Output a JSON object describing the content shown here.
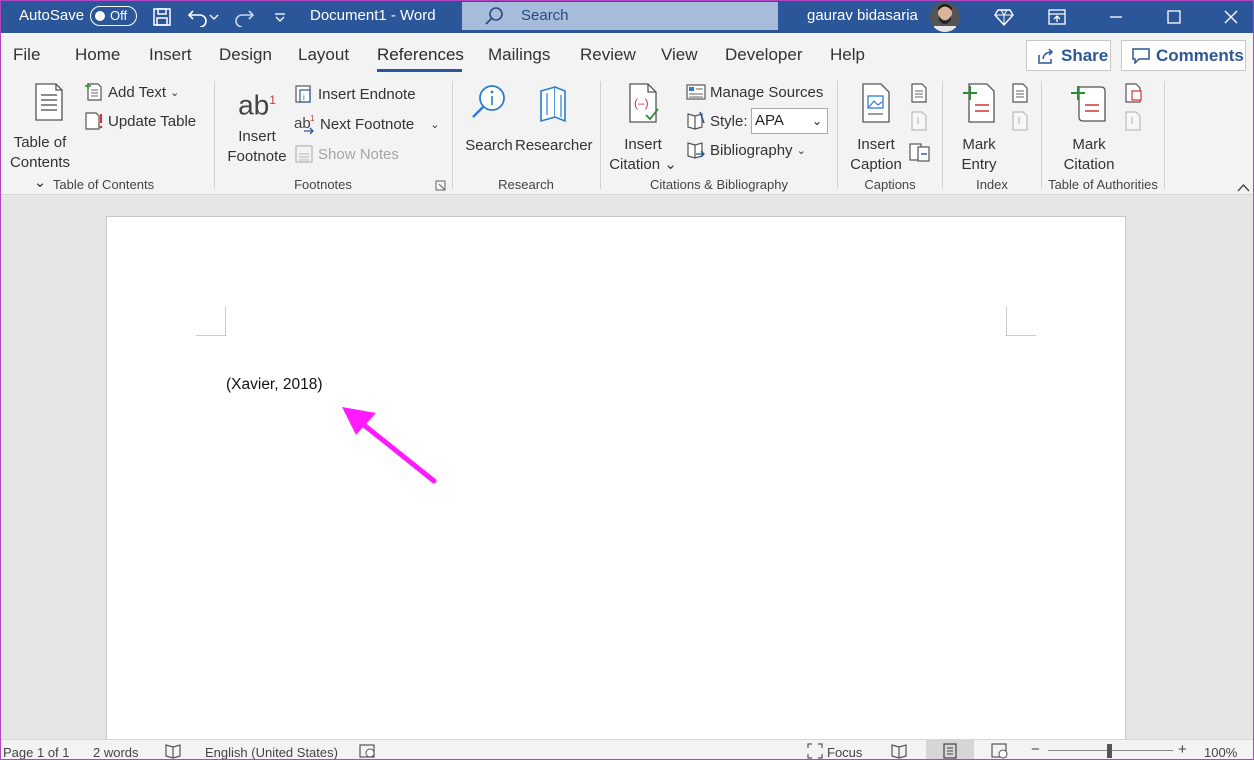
{
  "window": {
    "autosave_label": "AutoSave",
    "autosave_state": "Off",
    "doc_title": "Document1  -  Word",
    "search_placeholder": "Search",
    "user_name": "gaurav bidasaria"
  },
  "tabs": [
    "File",
    "Home",
    "Insert",
    "Design",
    "Layout",
    "References",
    "Mailings",
    "Review",
    "View",
    "Developer",
    "Help"
  ],
  "active_tab": "References",
  "header_buttons": {
    "share": "Share",
    "comments": "Comments"
  },
  "ribbon": {
    "toc": {
      "main_line1": "Table of",
      "main_line2": "Contents",
      "add_text": "Add Text",
      "update_table": "Update Table",
      "group": "Table of Contents"
    },
    "footnotes": {
      "insert_line1": "Insert",
      "insert_line2": "Footnote",
      "insert_endnote": "Insert Endnote",
      "next_footnote": "Next Footnote",
      "show_notes": "Show Notes",
      "group": "Footnotes"
    },
    "research": {
      "search": "Search",
      "researcher": "Researcher",
      "group": "Research"
    },
    "citations": {
      "insert_line1": "Insert",
      "insert_line2": "Citation",
      "manage_sources": "Manage Sources",
      "style_label": "Style:",
      "style_value": "APA",
      "bibliography": "Bibliography",
      "group": "Citations & Bibliography"
    },
    "captions": {
      "insert_line1": "Insert",
      "insert_line2": "Caption",
      "group": "Captions"
    },
    "index": {
      "mark_line1": "Mark",
      "mark_line2": "Entry",
      "group": "Index"
    },
    "authorities": {
      "mark_line1": "Mark",
      "mark_line2": "Citation",
      "group": "Table of Authorities"
    }
  },
  "document": {
    "text": "(Xavier, 2018)"
  },
  "status": {
    "page": "Page 1 of 1",
    "words": "2 words",
    "language": "English (United States)",
    "focus": "Focus",
    "zoom": "100%"
  },
  "colors": {
    "title_bar": "#2b579a",
    "annotation_arrow": "#ff1aff"
  }
}
